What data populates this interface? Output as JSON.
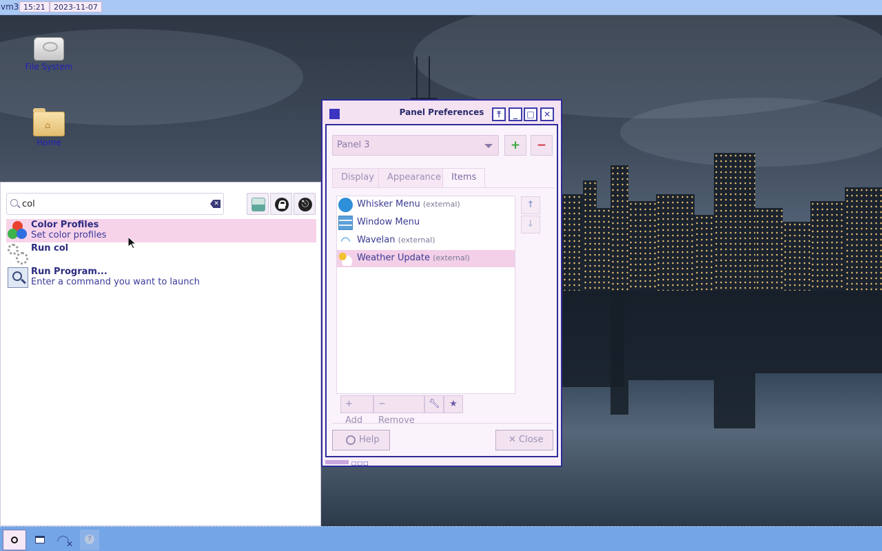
{
  "top_panel": {
    "hostname": "vm3",
    "time": "15:21",
    "date": "2023-11-07"
  },
  "desktop_icons": [
    {
      "label": "File System",
      "icon": "drive-icon"
    },
    {
      "label": "Home",
      "icon": "home-folder-icon"
    }
  ],
  "whisker_menu": {
    "search": {
      "value": "col",
      "placeholder": ""
    },
    "results": [
      {
        "title": "Color Profiles",
        "subtitle": "Set color profiles",
        "icon": "color-profiles-icon",
        "selected": true
      },
      {
        "title": "Run col",
        "subtitle": "",
        "icon": "gears-icon",
        "selected": false
      },
      {
        "title": "Run Program...",
        "subtitle": "Enter a command you want to launch",
        "icon": "run-program-icon",
        "selected": false
      }
    ]
  },
  "dialog": {
    "title": "Panel Preferences",
    "panel_select": "Panel 3",
    "tabs": [
      {
        "label": "Display",
        "active": false
      },
      {
        "label": "Appearance",
        "active": false
      },
      {
        "label": "Items",
        "active": true
      }
    ],
    "items": [
      {
        "name": "Whisker Menu",
        "suffix": "(external)",
        "icon": "whisker-menu-icon"
      },
      {
        "name": "Window Menu",
        "suffix": "",
        "icon": "window-menu-icon"
      },
      {
        "name": "Wavelan",
        "suffix": "(external)",
        "icon": "wifi-icon"
      },
      {
        "name": "Weather Update",
        "suffix": "(external)",
        "icon": "weather-icon",
        "selected": true
      }
    ],
    "add_label": "Add",
    "remove_label": "Remove",
    "help_label": "Help",
    "close_label": "Close"
  },
  "colors": {
    "accent": "#2e2a9a",
    "selection": "#f3cfe8",
    "panel": "#74a5e6"
  }
}
